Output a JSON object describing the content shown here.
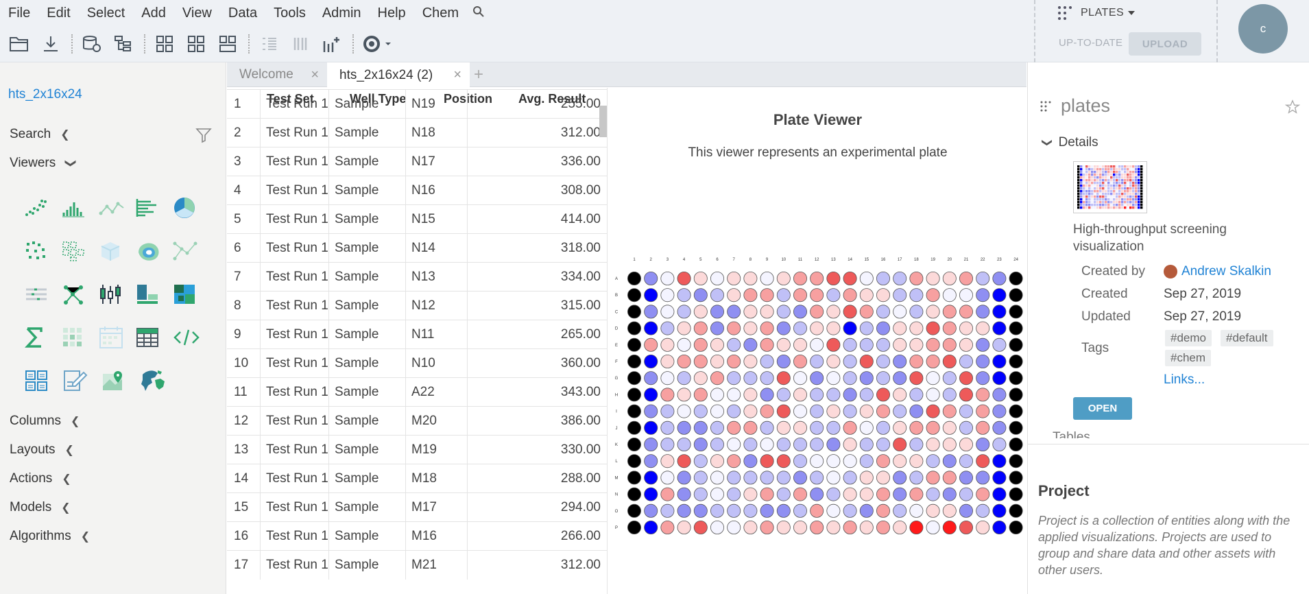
{
  "menu": [
    "File",
    "Edit",
    "Select",
    "Add",
    "View",
    "Data",
    "Tools",
    "Admin",
    "Help",
    "Chem"
  ],
  "plates_panel": {
    "title": "PLATES",
    "status": "UP-TO-DATE",
    "upload": "UPLOAD"
  },
  "user": {
    "initial": "c"
  },
  "sidebar": {
    "table_link": "hts_2x16x24",
    "sections": [
      "Search",
      "Viewers",
      "Columns",
      "Layouts",
      "Actions",
      "Models",
      "Algorithms"
    ]
  },
  "tabs": [
    {
      "label": "Welcome"
    },
    {
      "label": "hts_2x16x24 (2)"
    }
  ],
  "grid": {
    "headers": [
      "Test Set",
      "Well Type",
      "Position",
      "Avg. Result"
    ],
    "rows": [
      [
        "1",
        "Test Run 1",
        "Sample",
        "N19",
        "255.00"
      ],
      [
        "2",
        "Test Run 1",
        "Sample",
        "N18",
        "312.00"
      ],
      [
        "3",
        "Test Run 1",
        "Sample",
        "N17",
        "336.00"
      ],
      [
        "4",
        "Test Run 1",
        "Sample",
        "N16",
        "308.00"
      ],
      [
        "5",
        "Test Run 1",
        "Sample",
        "N15",
        "414.00"
      ],
      [
        "6",
        "Test Run 1",
        "Sample",
        "N14",
        "318.00"
      ],
      [
        "7",
        "Test Run 1",
        "Sample",
        "N13",
        "334.00"
      ],
      [
        "8",
        "Test Run 1",
        "Sample",
        "N12",
        "315.00"
      ],
      [
        "9",
        "Test Run 1",
        "Sample",
        "N11",
        "265.00"
      ],
      [
        "10",
        "Test Run 1",
        "Sample",
        "N10",
        "360.00"
      ],
      [
        "11",
        "Test Run 1",
        "Sample",
        "A22",
        "343.00"
      ],
      [
        "12",
        "Test Run 1",
        "Sample",
        "M20",
        "386.00"
      ],
      [
        "13",
        "Test Run 1",
        "Sample",
        "M19",
        "330.00"
      ],
      [
        "14",
        "Test Run 1",
        "Sample",
        "M18",
        "288.00"
      ],
      [
        "15",
        "Test Run 1",
        "Sample",
        "M17",
        "294.00"
      ],
      [
        "16",
        "Test Run 1",
        "Sample",
        "M16",
        "266.00"
      ],
      [
        "17",
        "Test Run 1",
        "Sample",
        "M21",
        "312.00"
      ]
    ]
  },
  "plate_viewer": {
    "title": "Plate Viewer",
    "description": "This viewer represents an experimental plate",
    "col_labels": [
      "1",
      "2",
      "3",
      "4",
      "5",
      "6",
      "7",
      "8",
      "9",
      "10",
      "11",
      "12",
      "13",
      "14",
      "15",
      "16",
      "17",
      "18",
      "19",
      "20",
      "21",
      "22",
      "23",
      "24"
    ],
    "row_labels": [
      "A",
      "B",
      "C",
      "D",
      "E",
      "F",
      "G",
      "H",
      "I",
      "J",
      "K",
      "L",
      "M",
      "N",
      "O",
      "P"
    ],
    "palette": {
      "K": "#000000",
      "b": "#0000ff",
      "B": "#8f8ff2",
      "c": "#c0c0f7",
      "w": "#f4f4ff",
      "s": "#fcd9d9",
      "r": "#f7a0a0",
      "R": "#ee5a5a",
      "X": "#ff1a1a"
    },
    "wells": [
      "KBwRswsswsrrRRwccrssrcBK",
      "KbwcBcsrrcrrcrssccrwwBbK",
      "KBwcsBBsscBrsRrcwcsrrBbK",
      "KbcsrBrsrBcssbcBssRrssbK",
      "KrswrscBrsswRcccssrrsBcK",
      "KbsrrsrscBrcscRcBrrRcBbK",
      "KBwcsrcccRwBwcBcBRwcRBbK",
      "KbrsrwwsBcsccBcRscwcRrBK",
      "KBcwcwcsrRwcscsrcBRrcrBK",
      "KbcBBcrrcssccrwcsrrscrBK",
      "KBccBcwcwcccBsccRcsssBcK",
      "KBsRcsrBRRcwwwcrsscBcRbK",
      "KbwBcwccccBcwcssBcrrBBbK",
      "KbrBcwcsrcrBcssrBrcBcrbK",
      "KBcBBcccBBcrwcBrcwssBcbK",
      "KbrsRwwsrssrsrsrsXwXRsbK"
    ]
  },
  "props": {
    "title": "plates",
    "details_label": "Details",
    "description": "High-throughput screening visualization",
    "fields": [
      {
        "key": "Created by",
        "value": "Andrew Skalkin"
      },
      {
        "key": "Created",
        "value": "Sep 27, 2019"
      },
      {
        "key": "Updated",
        "value": "Sep 27, 2019"
      },
      {
        "key": "Tags",
        "value": ""
      }
    ],
    "tags": [
      "#demo",
      "#default",
      "#chem"
    ],
    "links": "Links...",
    "open_label": "OPEN",
    "cut_label": "Tables"
  },
  "project": {
    "title": "Project",
    "description": "Project is a collection of entities along with the applied visualizations. Projects are used to group and share data and other assets with other users."
  },
  "colors": {
    "accent": "#2083d5",
    "viewer_icon_green": "#2fa66e",
    "open_button": "#4f9dc5"
  }
}
